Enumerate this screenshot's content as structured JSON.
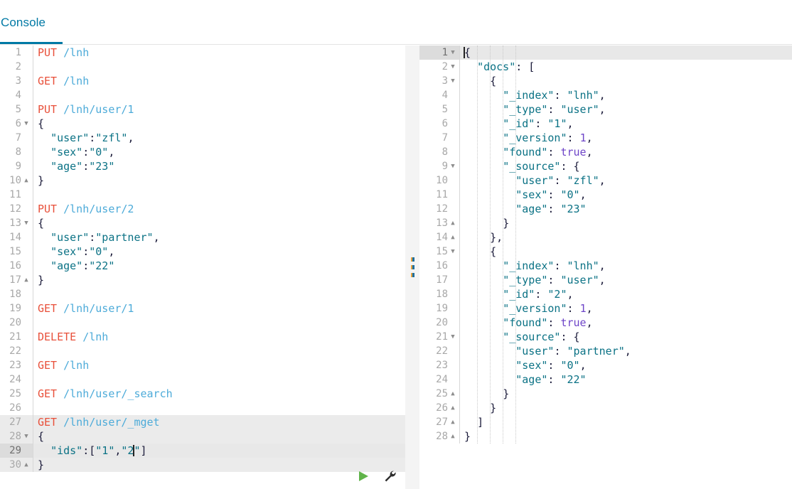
{
  "window": {
    "title": "Console"
  },
  "tabs": [
    {
      "id": "console",
      "label": "Console",
      "active": true
    }
  ],
  "colors": {
    "accent": "#0079a5",
    "method": "#e8503a",
    "url": "#4dabd9",
    "string": "#0b7285",
    "number": "#6e45c8",
    "boolean": "#6e45c8",
    "punctuation": "#1b1b3a",
    "gutter_text": "#a8a8a8",
    "active_line": "#e8e8e8",
    "splitter_bg": "#f4f4f4",
    "play_icon": "#60b44a",
    "wrench_icon": "#2d2d2d"
  },
  "editor": {
    "name": "request-editor",
    "active_line": 29,
    "caret": {
      "line": 29,
      "column": 17
    },
    "highlighted_request_lines": [
      27,
      28,
      29,
      30
    ],
    "fold_down_lines": [
      6,
      13,
      28
    ],
    "fold_up_lines": [
      10,
      17,
      30
    ],
    "actions": {
      "play_label": "play-icon",
      "wrench_label": "wrench-icon"
    },
    "lines": [
      {
        "n": 1,
        "tokens": [
          {
            "t": "method",
            "v": "PUT"
          },
          {
            "t": "plain",
            "v": " "
          },
          {
            "t": "url",
            "v": "/lnh"
          }
        ]
      },
      {
        "n": 2,
        "tokens": []
      },
      {
        "n": 3,
        "tokens": [
          {
            "t": "method",
            "v": "GET"
          },
          {
            "t": "plain",
            "v": " "
          },
          {
            "t": "url",
            "v": "/lnh"
          }
        ]
      },
      {
        "n": 4,
        "tokens": []
      },
      {
        "n": 5,
        "tokens": [
          {
            "t": "method",
            "v": "PUT"
          },
          {
            "t": "plain",
            "v": " "
          },
          {
            "t": "url",
            "v": "/lnh/user/1"
          }
        ]
      },
      {
        "n": 6,
        "tokens": [
          {
            "t": "brace",
            "v": "{"
          }
        ]
      },
      {
        "n": 7,
        "tokens": [
          {
            "t": "plain",
            "v": "  "
          },
          {
            "t": "str",
            "v": "\"user\""
          },
          {
            "t": "punc",
            "v": ":"
          },
          {
            "t": "str",
            "v": "\"zfl\""
          },
          {
            "t": "punc",
            "v": ","
          }
        ]
      },
      {
        "n": 8,
        "tokens": [
          {
            "t": "plain",
            "v": "  "
          },
          {
            "t": "str",
            "v": "\"sex\""
          },
          {
            "t": "punc",
            "v": ":"
          },
          {
            "t": "str",
            "v": "\"0\""
          },
          {
            "t": "punc",
            "v": ","
          }
        ]
      },
      {
        "n": 9,
        "tokens": [
          {
            "t": "plain",
            "v": "  "
          },
          {
            "t": "str",
            "v": "\"age\""
          },
          {
            "t": "punc",
            "v": ":"
          },
          {
            "t": "str",
            "v": "\"23\""
          }
        ]
      },
      {
        "n": 10,
        "tokens": [
          {
            "t": "brace",
            "v": "}"
          }
        ]
      },
      {
        "n": 11,
        "tokens": []
      },
      {
        "n": 12,
        "tokens": [
          {
            "t": "method",
            "v": "PUT"
          },
          {
            "t": "plain",
            "v": " "
          },
          {
            "t": "url",
            "v": "/lnh/user/2"
          }
        ]
      },
      {
        "n": 13,
        "tokens": [
          {
            "t": "brace",
            "v": "{"
          }
        ]
      },
      {
        "n": 14,
        "tokens": [
          {
            "t": "plain",
            "v": "  "
          },
          {
            "t": "str",
            "v": "\"user\""
          },
          {
            "t": "punc",
            "v": ":"
          },
          {
            "t": "str",
            "v": "\"partner\""
          },
          {
            "t": "punc",
            "v": ","
          }
        ]
      },
      {
        "n": 15,
        "tokens": [
          {
            "t": "plain",
            "v": "  "
          },
          {
            "t": "str",
            "v": "\"sex\""
          },
          {
            "t": "punc",
            "v": ":"
          },
          {
            "t": "str",
            "v": "\"0\""
          },
          {
            "t": "punc",
            "v": ","
          }
        ]
      },
      {
        "n": 16,
        "tokens": [
          {
            "t": "plain",
            "v": "  "
          },
          {
            "t": "str",
            "v": "\"age\""
          },
          {
            "t": "punc",
            "v": ":"
          },
          {
            "t": "str",
            "v": "\"22\""
          }
        ]
      },
      {
        "n": 17,
        "tokens": [
          {
            "t": "brace",
            "v": "}"
          }
        ]
      },
      {
        "n": 18,
        "tokens": []
      },
      {
        "n": 19,
        "tokens": [
          {
            "t": "method",
            "v": "GET"
          },
          {
            "t": "plain",
            "v": " "
          },
          {
            "t": "url",
            "v": "/lnh/user/1"
          }
        ]
      },
      {
        "n": 20,
        "tokens": []
      },
      {
        "n": 21,
        "tokens": [
          {
            "t": "method",
            "v": "DELETE"
          },
          {
            "t": "plain",
            "v": " "
          },
          {
            "t": "url",
            "v": "/lnh"
          }
        ]
      },
      {
        "n": 22,
        "tokens": []
      },
      {
        "n": 23,
        "tokens": [
          {
            "t": "method",
            "v": "GET"
          },
          {
            "t": "plain",
            "v": " "
          },
          {
            "t": "url",
            "v": "/lnh"
          }
        ]
      },
      {
        "n": 24,
        "tokens": []
      },
      {
        "n": 25,
        "tokens": [
          {
            "t": "method",
            "v": "GET"
          },
          {
            "t": "plain",
            "v": " "
          },
          {
            "t": "url",
            "v": "/lnh/user/_search"
          }
        ]
      },
      {
        "n": 26,
        "tokens": []
      },
      {
        "n": 27,
        "tokens": [
          {
            "t": "method",
            "v": "GET"
          },
          {
            "t": "plain",
            "v": " "
          },
          {
            "t": "url",
            "v": "/lnh/user/_mget"
          }
        ]
      },
      {
        "n": 28,
        "tokens": [
          {
            "t": "brace",
            "v": "{"
          }
        ]
      },
      {
        "n": 29,
        "tokens": [
          {
            "t": "plain",
            "v": "  "
          },
          {
            "t": "str",
            "v": "\"ids\""
          },
          {
            "t": "punc",
            "v": ":["
          },
          {
            "t": "str",
            "v": "\"1\""
          },
          {
            "t": "punc",
            "v": ","
          },
          {
            "t": "str",
            "v": "\"2"
          },
          {
            "t": "caret",
            "v": ""
          },
          {
            "t": "str",
            "v": "\""
          },
          {
            "t": "punc",
            "v": "]"
          }
        ]
      },
      {
        "n": 30,
        "tokens": [
          {
            "t": "brace",
            "v": "}"
          }
        ]
      }
    ]
  },
  "response": {
    "name": "response-viewer",
    "active_line": 1,
    "caret": {
      "line": 1,
      "column": 1
    },
    "fold_down_lines": [
      1,
      2,
      3,
      9,
      15,
      21
    ],
    "fold_up_lines": [
      13,
      14,
      25,
      26,
      27,
      28
    ],
    "lines": [
      {
        "n": 1,
        "tokens": [
          {
            "t": "brace",
            "v": "{"
          }
        ]
      },
      {
        "n": 2,
        "tokens": [
          {
            "t": "plain",
            "v": "  "
          },
          {
            "t": "key",
            "v": "\"docs\""
          },
          {
            "t": "punc",
            "v": ": ["
          }
        ]
      },
      {
        "n": 3,
        "tokens": [
          {
            "t": "plain",
            "v": "    "
          },
          {
            "t": "brace",
            "v": "{"
          }
        ]
      },
      {
        "n": 4,
        "tokens": [
          {
            "t": "plain",
            "v": "      "
          },
          {
            "t": "key",
            "v": "\"_index\""
          },
          {
            "t": "punc",
            "v": ": "
          },
          {
            "t": "str",
            "v": "\"lnh\""
          },
          {
            "t": "punc",
            "v": ","
          }
        ]
      },
      {
        "n": 5,
        "tokens": [
          {
            "t": "plain",
            "v": "      "
          },
          {
            "t": "key",
            "v": "\"_type\""
          },
          {
            "t": "punc",
            "v": ": "
          },
          {
            "t": "str",
            "v": "\"user\""
          },
          {
            "t": "punc",
            "v": ","
          }
        ]
      },
      {
        "n": 6,
        "tokens": [
          {
            "t": "plain",
            "v": "      "
          },
          {
            "t": "key",
            "v": "\"_id\""
          },
          {
            "t": "punc",
            "v": ": "
          },
          {
            "t": "str",
            "v": "\"1\""
          },
          {
            "t": "punc",
            "v": ","
          }
        ]
      },
      {
        "n": 7,
        "tokens": [
          {
            "t": "plain",
            "v": "      "
          },
          {
            "t": "key",
            "v": "\"_version\""
          },
          {
            "t": "punc",
            "v": ": "
          },
          {
            "t": "num",
            "v": "1"
          },
          {
            "t": "punc",
            "v": ","
          }
        ]
      },
      {
        "n": 8,
        "tokens": [
          {
            "t": "plain",
            "v": "      "
          },
          {
            "t": "key",
            "v": "\"found\""
          },
          {
            "t": "punc",
            "v": ": "
          },
          {
            "t": "bool",
            "v": "true"
          },
          {
            "t": "punc",
            "v": ","
          }
        ]
      },
      {
        "n": 9,
        "tokens": [
          {
            "t": "plain",
            "v": "      "
          },
          {
            "t": "key",
            "v": "\"_source\""
          },
          {
            "t": "punc",
            "v": ": {"
          }
        ]
      },
      {
        "n": 10,
        "tokens": [
          {
            "t": "plain",
            "v": "        "
          },
          {
            "t": "key",
            "v": "\"user\""
          },
          {
            "t": "punc",
            "v": ": "
          },
          {
            "t": "str",
            "v": "\"zfl\""
          },
          {
            "t": "punc",
            "v": ","
          }
        ]
      },
      {
        "n": 11,
        "tokens": [
          {
            "t": "plain",
            "v": "        "
          },
          {
            "t": "key",
            "v": "\"sex\""
          },
          {
            "t": "punc",
            "v": ": "
          },
          {
            "t": "str",
            "v": "\"0\""
          },
          {
            "t": "punc",
            "v": ","
          }
        ]
      },
      {
        "n": 12,
        "tokens": [
          {
            "t": "plain",
            "v": "        "
          },
          {
            "t": "key",
            "v": "\"age\""
          },
          {
            "t": "punc",
            "v": ": "
          },
          {
            "t": "str",
            "v": "\"23\""
          }
        ]
      },
      {
        "n": 13,
        "tokens": [
          {
            "t": "plain",
            "v": "      "
          },
          {
            "t": "brace",
            "v": "}"
          }
        ]
      },
      {
        "n": 14,
        "tokens": [
          {
            "t": "plain",
            "v": "    "
          },
          {
            "t": "brace",
            "v": "},"
          }
        ]
      },
      {
        "n": 15,
        "tokens": [
          {
            "t": "plain",
            "v": "    "
          },
          {
            "t": "brace",
            "v": "{"
          }
        ]
      },
      {
        "n": 16,
        "tokens": [
          {
            "t": "plain",
            "v": "      "
          },
          {
            "t": "key",
            "v": "\"_index\""
          },
          {
            "t": "punc",
            "v": ": "
          },
          {
            "t": "str",
            "v": "\"lnh\""
          },
          {
            "t": "punc",
            "v": ","
          }
        ]
      },
      {
        "n": 17,
        "tokens": [
          {
            "t": "plain",
            "v": "      "
          },
          {
            "t": "key",
            "v": "\"_type\""
          },
          {
            "t": "punc",
            "v": ": "
          },
          {
            "t": "str",
            "v": "\"user\""
          },
          {
            "t": "punc",
            "v": ","
          }
        ]
      },
      {
        "n": 18,
        "tokens": [
          {
            "t": "plain",
            "v": "      "
          },
          {
            "t": "key",
            "v": "\"_id\""
          },
          {
            "t": "punc",
            "v": ": "
          },
          {
            "t": "str",
            "v": "\"2\""
          },
          {
            "t": "punc",
            "v": ","
          }
        ]
      },
      {
        "n": 19,
        "tokens": [
          {
            "t": "plain",
            "v": "      "
          },
          {
            "t": "key",
            "v": "\"_version\""
          },
          {
            "t": "punc",
            "v": ": "
          },
          {
            "t": "num",
            "v": "1"
          },
          {
            "t": "punc",
            "v": ","
          }
        ]
      },
      {
        "n": 20,
        "tokens": [
          {
            "t": "plain",
            "v": "      "
          },
          {
            "t": "key",
            "v": "\"found\""
          },
          {
            "t": "punc",
            "v": ": "
          },
          {
            "t": "bool",
            "v": "true"
          },
          {
            "t": "punc",
            "v": ","
          }
        ]
      },
      {
        "n": 21,
        "tokens": [
          {
            "t": "plain",
            "v": "      "
          },
          {
            "t": "key",
            "v": "\"_source\""
          },
          {
            "t": "punc",
            "v": ": {"
          }
        ]
      },
      {
        "n": 22,
        "tokens": [
          {
            "t": "plain",
            "v": "        "
          },
          {
            "t": "key",
            "v": "\"user\""
          },
          {
            "t": "punc",
            "v": ": "
          },
          {
            "t": "str",
            "v": "\"partner\""
          },
          {
            "t": "punc",
            "v": ","
          }
        ]
      },
      {
        "n": 23,
        "tokens": [
          {
            "t": "plain",
            "v": "        "
          },
          {
            "t": "key",
            "v": "\"sex\""
          },
          {
            "t": "punc",
            "v": ": "
          },
          {
            "t": "str",
            "v": "\"0\""
          },
          {
            "t": "punc",
            "v": ","
          }
        ]
      },
      {
        "n": 24,
        "tokens": [
          {
            "t": "plain",
            "v": "        "
          },
          {
            "t": "key",
            "v": "\"age\""
          },
          {
            "t": "punc",
            "v": ": "
          },
          {
            "t": "str",
            "v": "\"22\""
          }
        ]
      },
      {
        "n": 25,
        "tokens": [
          {
            "t": "plain",
            "v": "      "
          },
          {
            "t": "brace",
            "v": "}"
          }
        ]
      },
      {
        "n": 26,
        "tokens": [
          {
            "t": "plain",
            "v": "    "
          },
          {
            "t": "brace",
            "v": "}"
          }
        ]
      },
      {
        "n": 27,
        "tokens": [
          {
            "t": "plain",
            "v": "  "
          },
          {
            "t": "brace",
            "v": "]"
          }
        ]
      },
      {
        "n": 28,
        "tokens": [
          {
            "t": "brace",
            "v": "}"
          }
        ]
      }
    ]
  },
  "splitter": {
    "name": "pane-splitter",
    "grip_dots": 3
  }
}
